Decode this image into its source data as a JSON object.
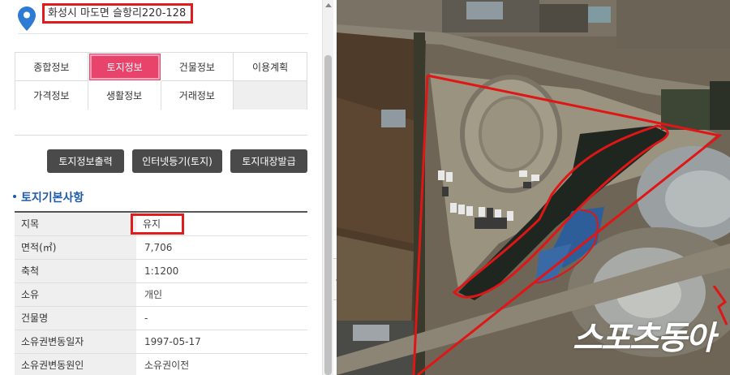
{
  "address": "화성시 마도면 슬항리220-128",
  "tabs": [
    {
      "label": "종합정보",
      "active": false
    },
    {
      "label": "토지정보",
      "active": true
    },
    {
      "label": "건물정보",
      "active": false
    },
    {
      "label": "이용계획",
      "active": false
    },
    {
      "label": "가격정보",
      "active": false
    },
    {
      "label": "생활정보",
      "active": false
    },
    {
      "label": "거래정보",
      "active": false
    },
    {
      "label": "",
      "active": false
    }
  ],
  "buttons": {
    "print": "토지정보출력",
    "registry": "인터넷등기(토지)",
    "ledger": "토지대장발급"
  },
  "section_title": "토지기본사항",
  "land_info": [
    {
      "key": "지목",
      "value": "유지"
    },
    {
      "key": "면적(㎡)",
      "value": "7,706"
    },
    {
      "key": "축척",
      "value": "1:1200"
    },
    {
      "key": "소유",
      "value": "개인"
    },
    {
      "key": "건물명",
      "value": "-"
    },
    {
      "key": "소유권변동일자",
      "value": "1997-05-17"
    },
    {
      "key": "소유권변동원인",
      "value": "소유권이전"
    }
  ],
  "watermark": "스포츠동아",
  "colors": {
    "highlight_red": "#e11c1c",
    "active_tab": "#e8436b",
    "section_blue": "#1f5aa7",
    "button_dark": "#4a4a4a",
    "pin_blue": "#2e7bd6"
  }
}
